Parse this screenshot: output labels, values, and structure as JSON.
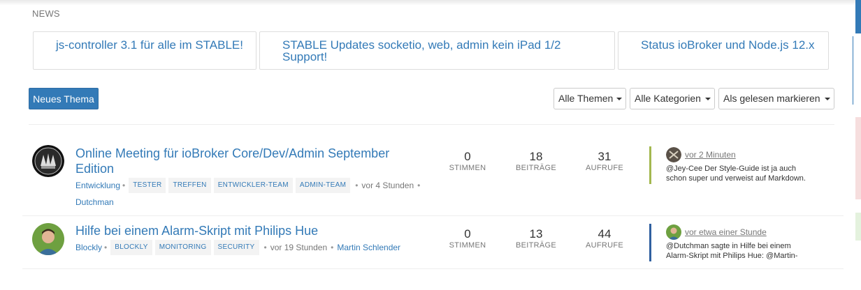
{
  "news": {
    "label": "NEWS",
    "items": [
      {
        "title": "js-controller 3.1 für alle im STABLE!"
      },
      {
        "title": "STABLE Updates socketio, web, admin kein iPad 1/2 Support!"
      },
      {
        "title": "Status ioBroker und Node.js 12.x"
      }
    ]
  },
  "toolbar": {
    "new_topic": "Neues Thema",
    "filter_topics": "Alle Themen",
    "filter_categories": "Alle Kategorien",
    "mark_read": "Als gelesen markieren"
  },
  "colors": {
    "accent": "#337ab7",
    "category_entwicklung": "#a3b84f",
    "category_blockly": "#3060a0"
  },
  "topics": [
    {
      "title_line1": "Online Meeting für ioBroker Core/Dev/Admin September",
      "title_line2": "Edition",
      "category": "Entwicklung",
      "tags": [
        "TESTER",
        "TREFFEN",
        "ENTWICKLER-TEAM",
        "ADMIN-TEAM"
      ],
      "time": "vor 4 Stunden",
      "author": "Dutchman",
      "votes": "0",
      "votes_label": "STIMMEN",
      "posts": "18",
      "posts_label": "BEITRÄGE",
      "views": "31",
      "views_label": "AUFRUFE",
      "teaser_time": "vor 2 Minuten",
      "teaser_line1": "@Jey-Cee Der Style-Guide ist ja auch",
      "teaser_line2": "schon super und verweist auf Markdown."
    },
    {
      "title_line1": "Hilfe bei einem Alarm-Skript mit Philips Hue",
      "category": "Blockly",
      "tags": [
        "BLOCKLY",
        "MONITORING",
        "SECURITY"
      ],
      "time": "vor 19 Stunden",
      "author": "Martin Schlender",
      "votes": "0",
      "votes_label": "STIMMEN",
      "posts": "13",
      "posts_label": "BEITRÄGE",
      "views": "44",
      "views_label": "AUFRUFE",
      "teaser_time": "vor etwa einer Stunde",
      "teaser_line1": "@Dutchman sagte in Hilfe bei einem",
      "teaser_line2": "Alarm-Skript mit Philips Hue: @Martin-"
    }
  ]
}
